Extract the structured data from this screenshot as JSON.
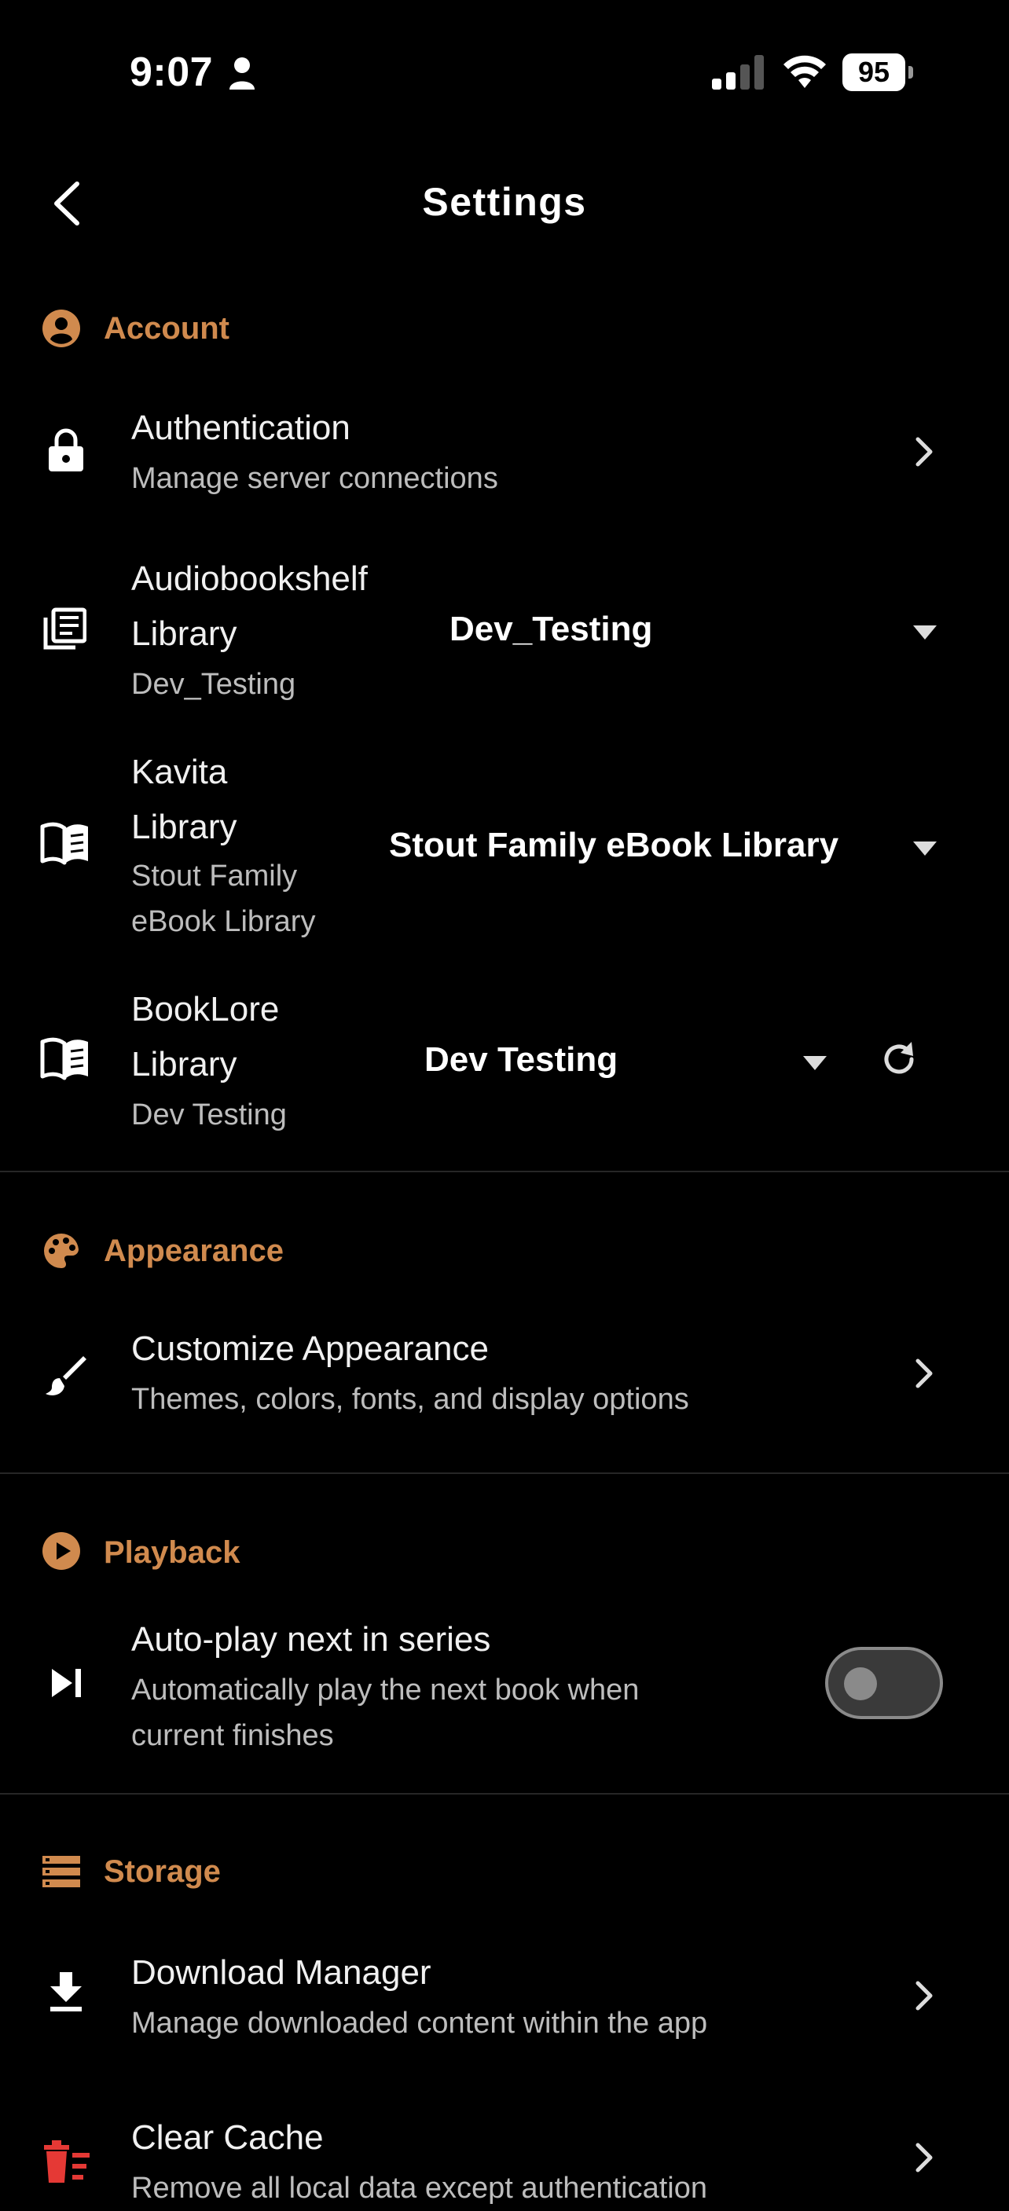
{
  "status_bar": {
    "time": "9:07",
    "battery": "95"
  },
  "header": {
    "title": "Settings"
  },
  "sections": {
    "account": {
      "label": "Account",
      "authentication": {
        "title": "Authentication",
        "subtitle": "Manage server connections"
      },
      "audiobookshelf": {
        "title_line1": "Audiobookshelf",
        "title_line2": "Library",
        "subtitle": "Dev_Testing",
        "selected": "Dev_Testing"
      },
      "kavita": {
        "title_line1": "Kavita",
        "title_line2": "Library",
        "subtitle_line1": "Stout Family",
        "subtitle_line2": "eBook Library",
        "selected": "Stout Family eBook Library"
      },
      "booklore": {
        "title_line1": "BookLore",
        "title_line2": "Library",
        "subtitle": "Dev Testing",
        "selected": "Dev Testing"
      }
    },
    "appearance": {
      "label": "Appearance",
      "customize": {
        "title": "Customize Appearance",
        "subtitle": "Themes, colors, fonts, and display options"
      }
    },
    "playback": {
      "label": "Playback",
      "autoplay": {
        "title": "Auto-play next in series",
        "subtitle_line1": "Automatically play the next book when",
        "subtitle_line2": "current finishes",
        "enabled": false
      }
    },
    "storage": {
      "label": "Storage",
      "download_manager": {
        "title": "Download Manager",
        "subtitle": "Manage downloaded content within the app"
      },
      "clear_cache": {
        "title": "Clear Cache",
        "subtitle": "Remove all local data except authentication"
      }
    }
  },
  "colors": {
    "accent": "#d08a4e",
    "background": "#000000",
    "danger": "#e53935"
  },
  "icons": [
    "person-icon",
    "signal-icon",
    "wifi-icon",
    "battery-icon",
    "back-icon",
    "account-icon",
    "lock-icon",
    "library-icon",
    "book-open-icon",
    "palette-icon",
    "brush-icon",
    "play-circle-icon",
    "skip-next-icon",
    "storage-icon",
    "download-icon",
    "delete-sweep-icon",
    "chevron-right-icon",
    "caret-down-icon",
    "refresh-icon"
  ]
}
